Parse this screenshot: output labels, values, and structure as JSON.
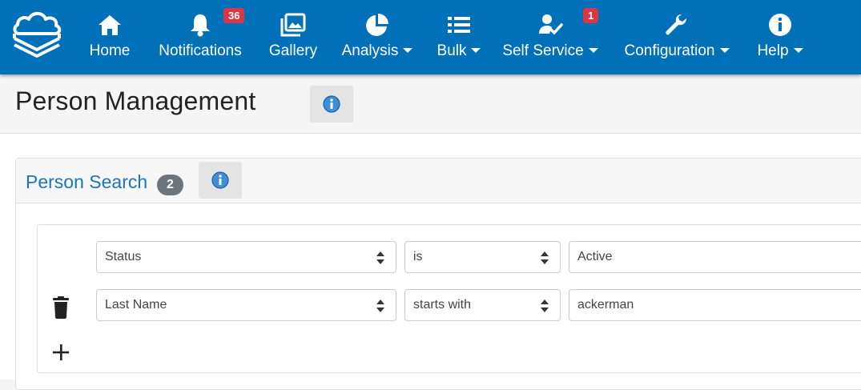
{
  "nav": {
    "home": {
      "label": "Home"
    },
    "notifications": {
      "label": "Notifications",
      "badge": "36"
    },
    "gallery": {
      "label": "Gallery"
    },
    "analysis": {
      "label": "Analysis"
    },
    "bulk": {
      "label": "Bulk"
    },
    "self_service": {
      "label": "Self Service",
      "badge": "1"
    },
    "configuration": {
      "label": "Configuration"
    },
    "help": {
      "label": "Help"
    }
  },
  "header": {
    "title": "Person Management"
  },
  "search": {
    "title": "Person Search",
    "count": "2",
    "rows": [
      {
        "field": "Status",
        "operator": "is",
        "value": "Active"
      },
      {
        "field": "Last Name",
        "operator": "starts with",
        "value": "ackerman"
      }
    ]
  },
  "colors": {
    "navbar": "#0070b8",
    "accent": "#1b75bb",
    "badge_red": "#dc3545",
    "badge_gray": "#6c757d"
  }
}
